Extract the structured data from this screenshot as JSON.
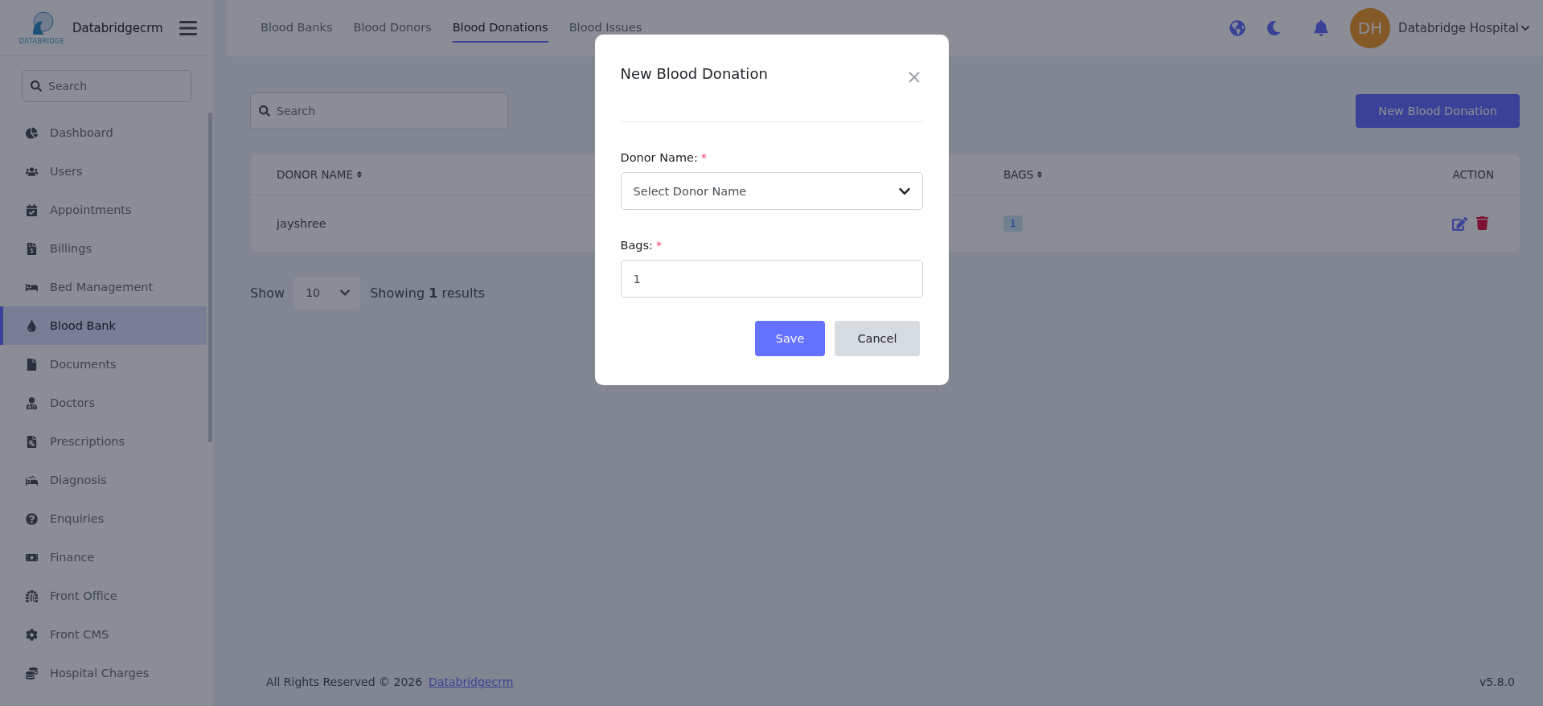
{
  "sidebar": {
    "brand": "Databridgecrm",
    "logo_text": "DATABRIDGE",
    "search_placeholder": "Search",
    "items": [
      {
        "label": "Dashboard",
        "selected": false
      },
      {
        "label": "Users",
        "selected": false
      },
      {
        "label": "Appointments",
        "selected": false
      },
      {
        "label": "Billings",
        "selected": false
      },
      {
        "label": "Bed Management",
        "selected": false
      },
      {
        "label": "Blood Bank",
        "selected": true
      },
      {
        "label": "Documents",
        "selected": false
      },
      {
        "label": "Doctors",
        "selected": false
      },
      {
        "label": "Prescriptions",
        "selected": false
      },
      {
        "label": "Diagnosis",
        "selected": false
      },
      {
        "label": "Enquiries",
        "selected": false
      },
      {
        "label": "Finance",
        "selected": false
      },
      {
        "label": "Front Office",
        "selected": false
      },
      {
        "label": "Front CMS",
        "selected": false
      },
      {
        "label": "Hospital Charges",
        "selected": false
      }
    ]
  },
  "topbar": {
    "tabs": [
      {
        "label": "Blood Banks",
        "selected": false
      },
      {
        "label": "Blood Donors",
        "selected": false
      },
      {
        "label": "Blood Donations",
        "selected": true
      },
      {
        "label": "Blood Issues",
        "selected": false
      }
    ],
    "user": {
      "initials": "DH",
      "name": "Databridge Hospital"
    }
  },
  "toolbar": {
    "search_placeholder": "Search",
    "new_button": "New Blood Donation"
  },
  "table": {
    "columns": [
      {
        "label": "DONOR NAME",
        "sortable": true
      },
      {
        "label": "BAGS",
        "sortable": true
      },
      {
        "label": "ACTION",
        "sortable": false
      }
    ],
    "rows": [
      {
        "donor_name": "jayshree",
        "bags": "1"
      }
    ]
  },
  "pagination": {
    "show_label": "Show",
    "page_size": "10",
    "summary": "Showing **1** results"
  },
  "footer": {
    "copyright": "All Rights Reserved © 2026",
    "link": "Databridgecrm",
    "version": "v5.8.0"
  },
  "modal": {
    "title": "New Blood Donation",
    "fields": [
      {
        "kind": "select",
        "label": "Donor Name:",
        "required_mark": "*",
        "placeholder": "Select Donor Name"
      },
      {
        "kind": "text",
        "label": "Bags:",
        "required_mark": "*",
        "value": "1"
      }
    ],
    "buttons": [
      {
        "label": "Save",
        "kind": "primary"
      },
      {
        "label": "Cancel",
        "kind": "secondary"
      }
    ]
  }
}
